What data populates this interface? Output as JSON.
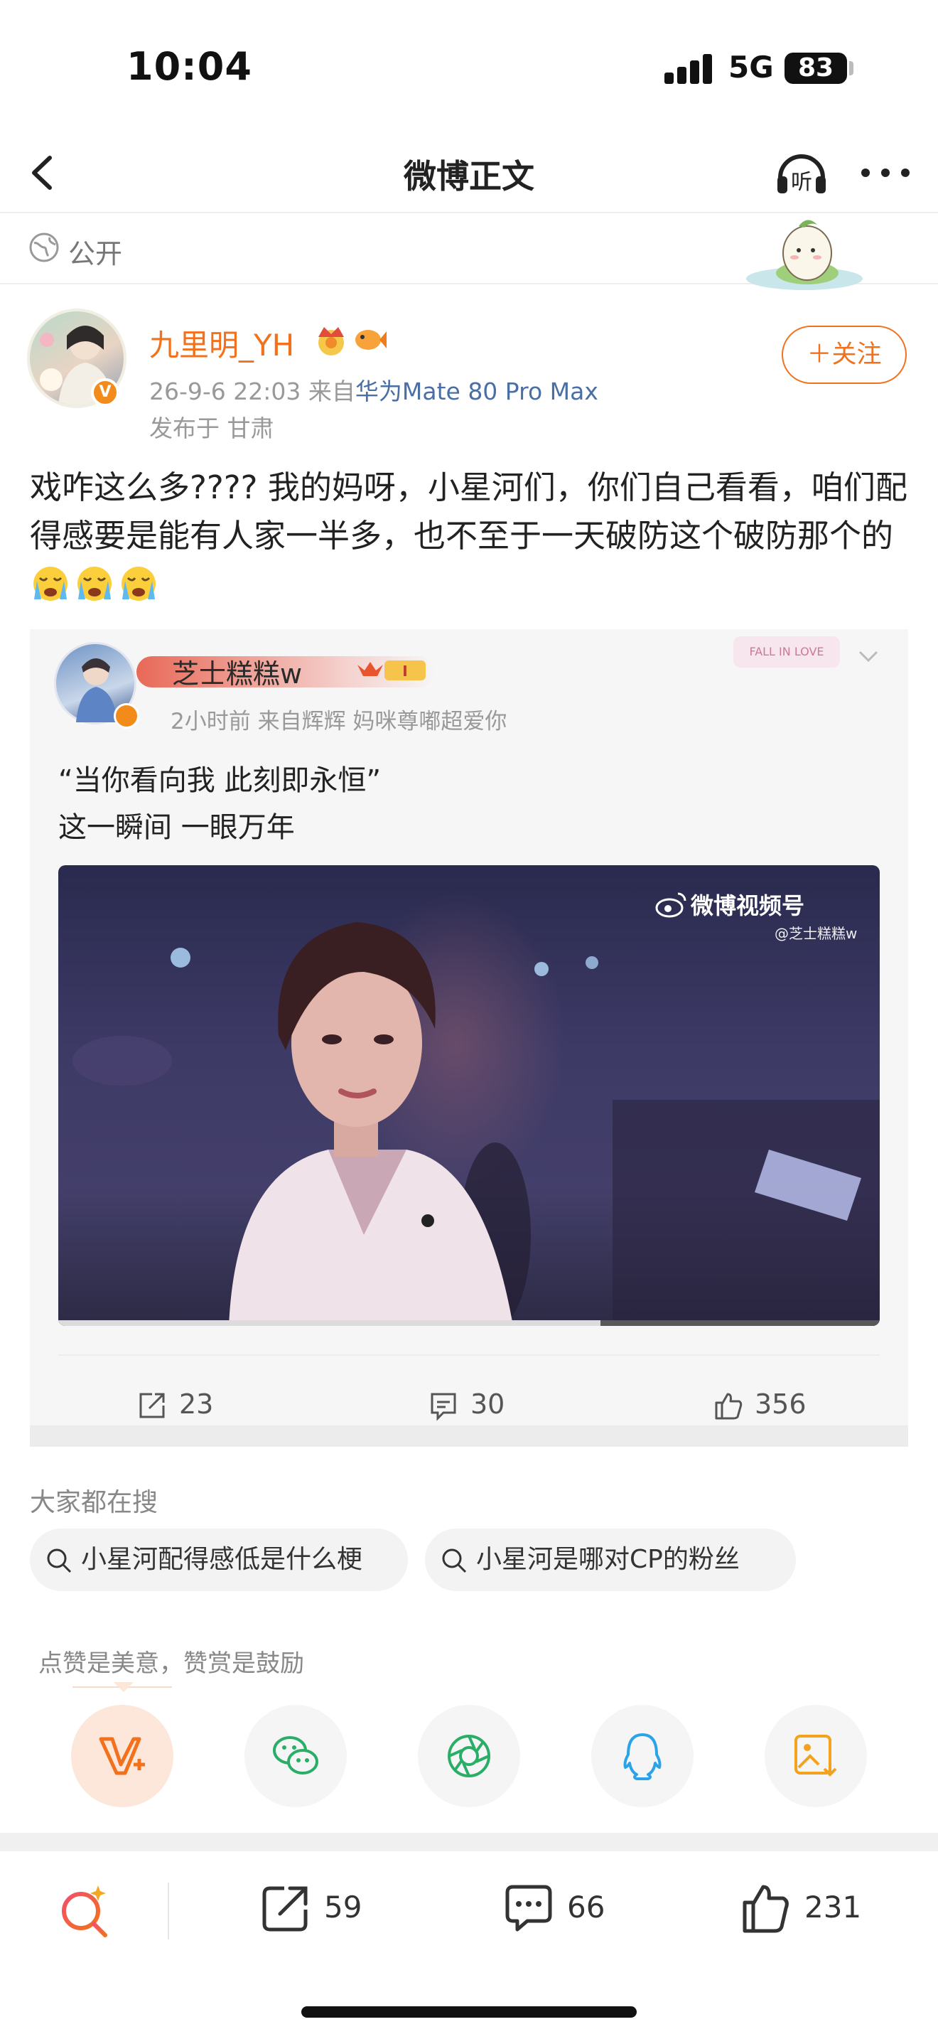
{
  "status_bar": {
    "time": "10:04",
    "network": "5G",
    "battery": "83"
  },
  "nav": {
    "title": "微博正文",
    "listen_label": "听"
  },
  "visibility": {
    "label": "公开"
  },
  "post": {
    "author": "九里明_YH",
    "meta_prefix": "26-9-6 22:03  来自",
    "device": "华为Mate 80 Pro Max",
    "location": "发布于 甘肃",
    "follow_label": "＋关注",
    "text": "戏咋这么多????  我的妈呀，小星河们，你们自己看看，咱们配得感要是能有人家一半多，也不至于一天破防这个破防那个的"
  },
  "repost": {
    "author": "芝士糕糕w",
    "level": "I",
    "time": "2小时前  来自辉辉 妈咪尊嘟超爱你",
    "sticker": "FALL IN LOVE",
    "line1": "“当你看向我 此刻即永恒”",
    "line2": "这一瞬间 一眼万年",
    "video": {
      "logo": "微博视频号",
      "watermark": "@芝士糕糕w",
      "progress": 0.66
    },
    "shares": "23",
    "comments": "30",
    "likes": "356"
  },
  "searches": {
    "title": "大家都在搜",
    "items": [
      "小星河配得感低是什么梗",
      "小星河是哪对CP的粉丝"
    ]
  },
  "reward": {
    "hint": "点赞是美意，赞赏是鼓励"
  },
  "share_targets": [
    "reward-icon",
    "wechat-icon",
    "moments-icon",
    "qq-icon",
    "save-image-icon"
  ],
  "bottom_bar": {
    "shares": "59",
    "comments": "66",
    "likes": "231"
  },
  "colors": {
    "accent": "#f2711c",
    "link": "#4a6fa5"
  }
}
